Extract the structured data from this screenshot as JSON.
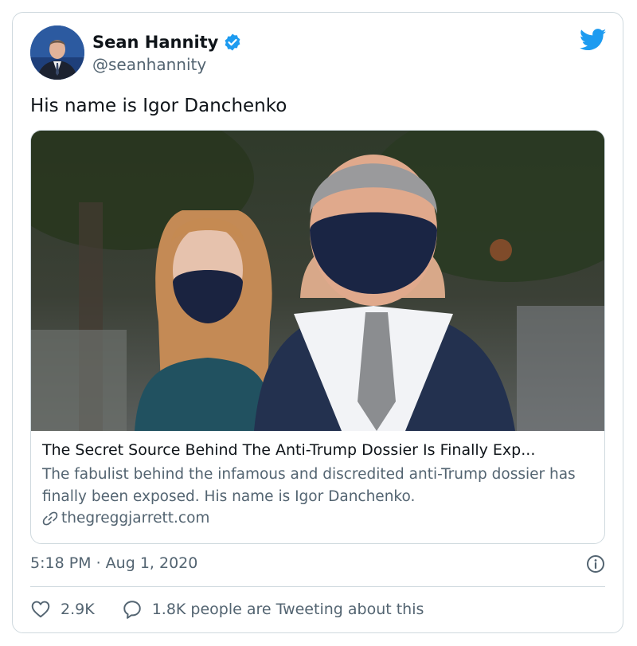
{
  "tweet": {
    "author": {
      "display_name": "Sean Hannity",
      "handle": "@seanhannity",
      "verified": true,
      "avatar_icon": "profile-photo"
    },
    "text": "His name is Igor Danchenko",
    "link_card": {
      "title": "The Secret Source Behind The Anti-Trump Dossier Is Finally Exp...",
      "description": "The fabulist behind the infamous and discredited anti-Trump dossier has finally been exposed.  His name is Igor Danchenko.",
      "domain": "thegreggjarrett.com",
      "link_icon": "link-icon",
      "image_alt": "Man and woman wearing navy face masks walking outdoors"
    },
    "timestamp": "5:18 PM · Aug 1, 2020",
    "actions": {
      "likes": "2.9K",
      "tweeting": "1.8K people are Tweeting about this"
    }
  },
  "colors": {
    "brand_blue": "#1d9bf0",
    "text_primary": "#0f1419",
    "text_secondary": "#536471",
    "border": "#cfd9de"
  }
}
